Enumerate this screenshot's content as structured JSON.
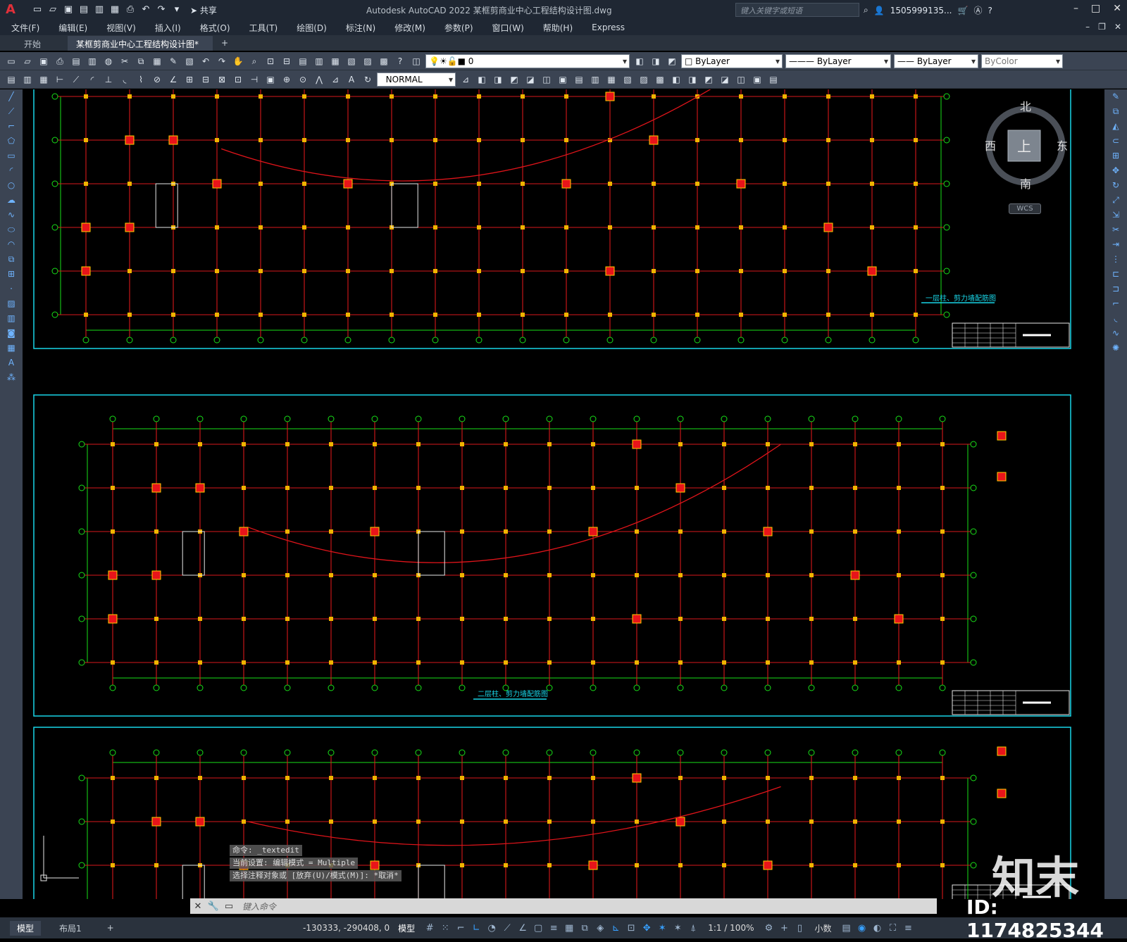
{
  "app": {
    "logo": "A",
    "window_title": "Autodesk AutoCAD 2022    某框剪商业中心工程结构设计图.dwg",
    "share": "共享",
    "search_placeholder": "键入关键字或短语",
    "user": "1505999135...",
    "help": "?"
  },
  "menu": [
    "文件(F)",
    "编辑(E)",
    "视图(V)",
    "插入(I)",
    "格式(O)",
    "工具(T)",
    "绘图(D)",
    "标注(N)",
    "修改(M)",
    "参数(P)",
    "窗口(W)",
    "帮助(H)",
    "Express"
  ],
  "tabs": {
    "start": "开始",
    "active": "某框剪商业中心工程结构设计图*",
    "new": "+"
  },
  "toolbar": {
    "layer_value": "0",
    "color": "ByLayer",
    "linetype": "ByLayer",
    "lineweight": "ByLayer",
    "plotstyle": "ByColor",
    "dimstyle": "NORMAL"
  },
  "viewcube": {
    "north": "北",
    "south": "南",
    "east": "东",
    "west": "西",
    "top": "上",
    "wcs": "WCS"
  },
  "drawing": {
    "plan1_title": "一层柱、剪力墙配筋图",
    "plan2_title": "二层柱、剪力墙配筋图"
  },
  "command": {
    "history": [
      "命令: _textedit",
      "当前设置: 编辑模式 = Multiple",
      "选择注释对象或 [放弃(U)/模式(M)]: *取消*"
    ],
    "placeholder": "键入命令"
  },
  "layouts": [
    "模型",
    "布局1",
    "+"
  ],
  "status": {
    "coords": "-130333, -290408, 0",
    "model": "模型",
    "scale": "1:1 / 100%",
    "units": "小数"
  },
  "watermark": {
    "logo": "知末",
    "id": "ID: 1174825344"
  }
}
